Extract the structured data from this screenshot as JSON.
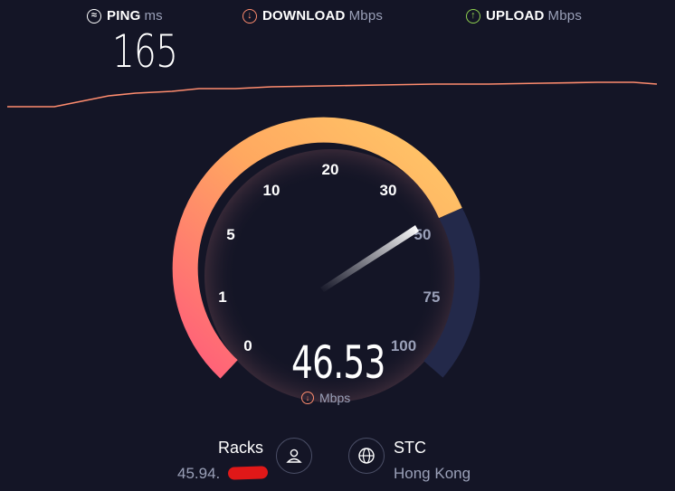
{
  "metrics": {
    "ping": {
      "label": "PING",
      "unit": "ms",
      "value": "165",
      "icon": "ping-icon"
    },
    "download": {
      "label": "DOWNLOAD",
      "unit": "Mbps",
      "icon": "download-arrow-icon",
      "color": "#ff8c6e"
    },
    "upload": {
      "label": "UPLOAD",
      "unit": "Mbps",
      "icon": "upload-arrow-icon",
      "color": "#8fd14f"
    }
  },
  "gauge": {
    "ticks": [
      "0",
      "1",
      "5",
      "10",
      "20",
      "30",
      "50",
      "75",
      "100"
    ],
    "needle_value": 46.53,
    "progress_color_start": "#ff6a7e",
    "progress_color_end": "#ffc868",
    "track_color": "#23294a"
  },
  "speed": {
    "value": "46.53",
    "unit": "Mbps"
  },
  "client": {
    "name": "Racks",
    "ip": "45.94.",
    "icon": "user-icon"
  },
  "server": {
    "name": "STC",
    "location": "Hong Kong",
    "icon": "globe-icon"
  }
}
